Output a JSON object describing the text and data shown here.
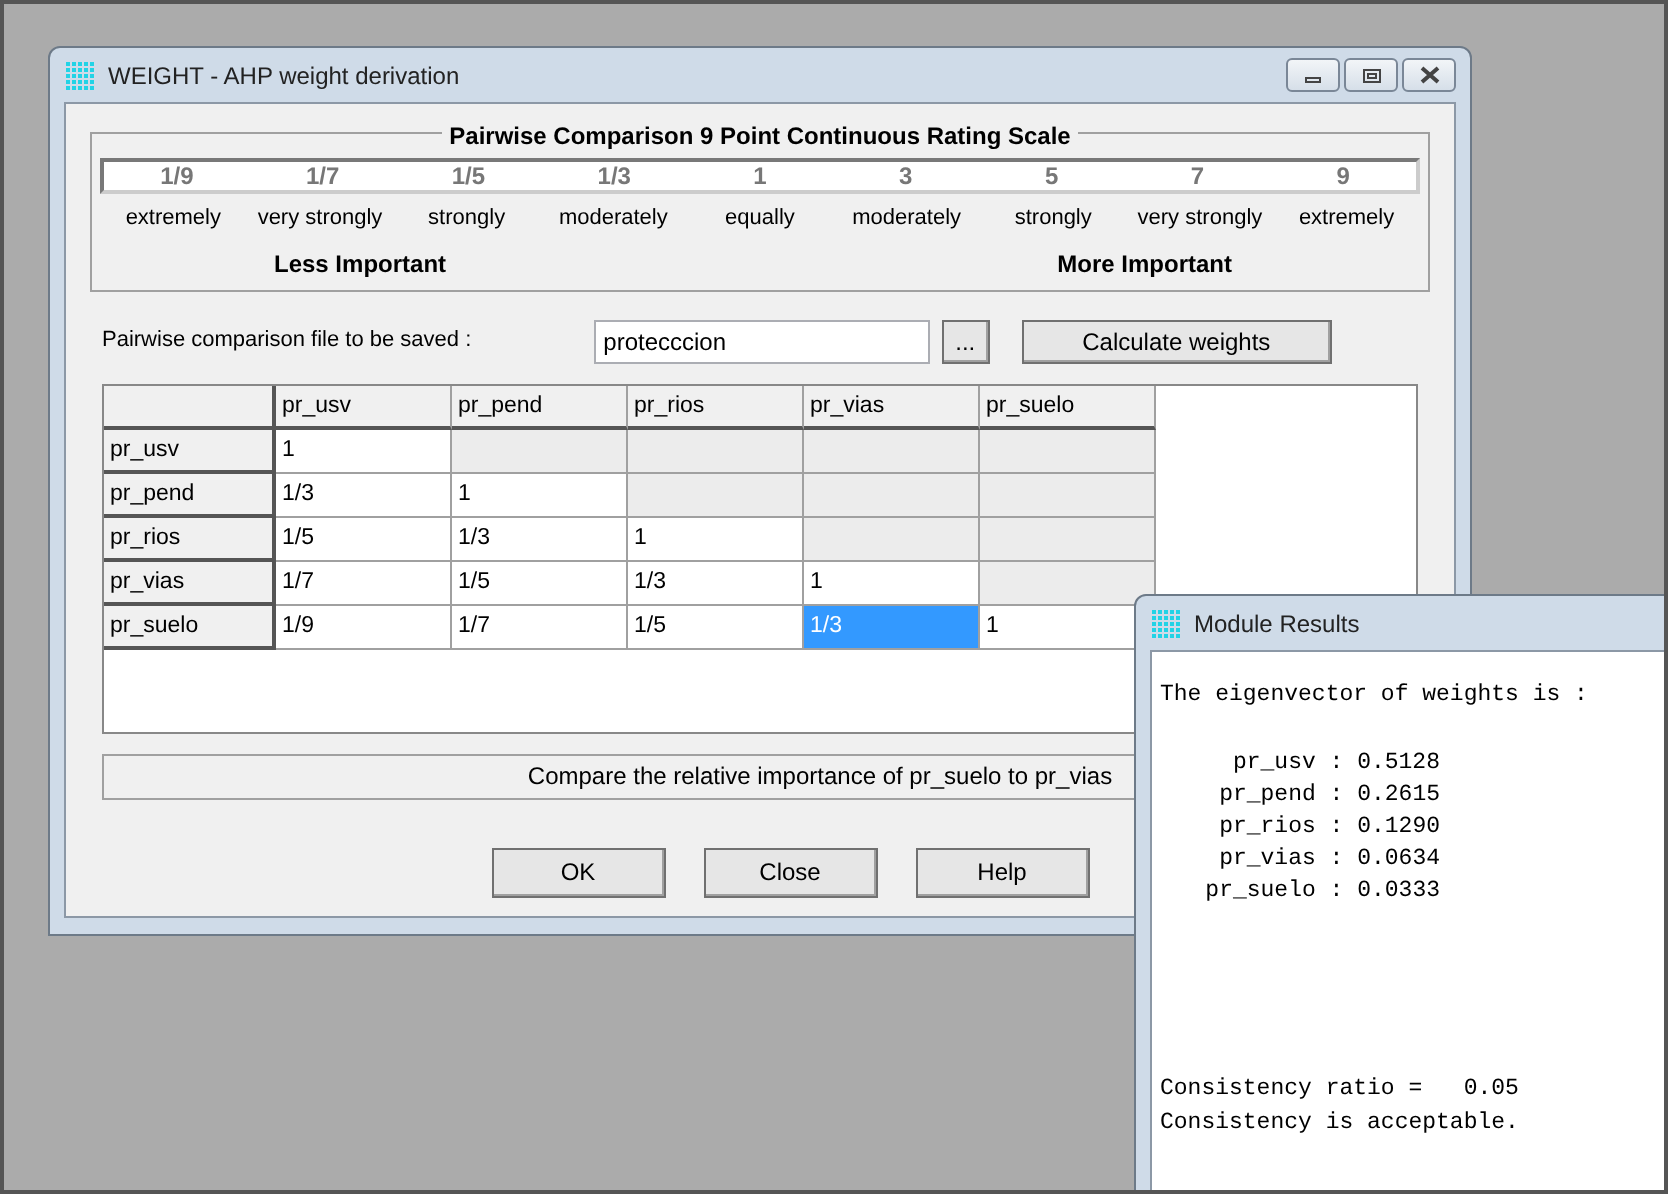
{
  "main_window": {
    "title": "WEIGHT - AHP weight derivation"
  },
  "scale": {
    "title": "Pairwise Comparison 9 Point Continuous Rating Scale",
    "points": [
      {
        "value": "1/9",
        "label": "extremely"
      },
      {
        "value": "1/7",
        "label": "very strongly"
      },
      {
        "value": "1/5",
        "label": "strongly"
      },
      {
        "value": "1/3",
        "label": "moderately"
      },
      {
        "value": "1",
        "label": "equally"
      },
      {
        "value": "3",
        "label": "moderately"
      },
      {
        "value": "5",
        "label": "strongly"
      },
      {
        "value": "7",
        "label": "very strongly"
      },
      {
        "value": "9",
        "label": "extremely"
      }
    ],
    "less_label": "Less Important",
    "more_label": "More Important"
  },
  "file": {
    "label": "Pairwise comparison file to be saved :",
    "value": "protecccion",
    "browse": "...",
    "calculate": "Calculate weights"
  },
  "matrix": {
    "columns": [
      "pr_usv",
      "pr_pend",
      "pr_rios",
      "pr_vias",
      "pr_suelo"
    ],
    "rows": [
      {
        "header": "pr_usv",
        "cells": [
          {
            "value": "1",
            "selected": false
          },
          {
            "selected": false
          },
          {
            "selected": false
          },
          {
            "selected": false
          },
          {
            "selected": false
          }
        ]
      },
      {
        "header": "pr_pend",
        "cells": [
          {
            "value": "1/3",
            "selected": false
          },
          {
            "value": "1",
            "selected": false
          },
          {
            "selected": false
          },
          {
            "selected": false
          },
          {
            "selected": false
          }
        ]
      },
      {
        "header": "pr_rios",
        "cells": [
          {
            "value": "1/5",
            "selected": false
          },
          {
            "value": "1/3",
            "selected": false
          },
          {
            "value": "1",
            "selected": false
          },
          {
            "selected": false
          },
          {
            "selected": false
          }
        ]
      },
      {
        "header": "pr_vias",
        "cells": [
          {
            "value": "1/7",
            "selected": false
          },
          {
            "value": "1/5",
            "selected": false
          },
          {
            "value": "1/3",
            "selected": false
          },
          {
            "value": "1",
            "selected": false
          },
          {
            "selected": false
          }
        ]
      },
      {
        "header": "pr_suelo",
        "cells": [
          {
            "value": "1/9",
            "selected": false
          },
          {
            "value": "1/7",
            "selected": false
          },
          {
            "value": "1/5",
            "selected": false
          },
          {
            "value": "1/3",
            "selected": true
          },
          {
            "value": "1",
            "selected": false
          }
        ]
      }
    ]
  },
  "status": "Compare the relative importance of pr_suelo to pr_vias",
  "buttons": [
    "OK",
    "Close",
    "Help"
  ],
  "results_window": {
    "title": "Module Results",
    "heading": "The eigenvector of weights is :",
    "weights": [
      "pr_usv : 0.5128",
      "pr_pend : 0.2615",
      "pr_rios : 0.1290",
      "pr_vias : 0.0634",
      "pr_suelo : 0.0333"
    ],
    "footer": [
      "Consistency ratio =   0.05",
      "Consistency is acceptable."
    ]
  }
}
